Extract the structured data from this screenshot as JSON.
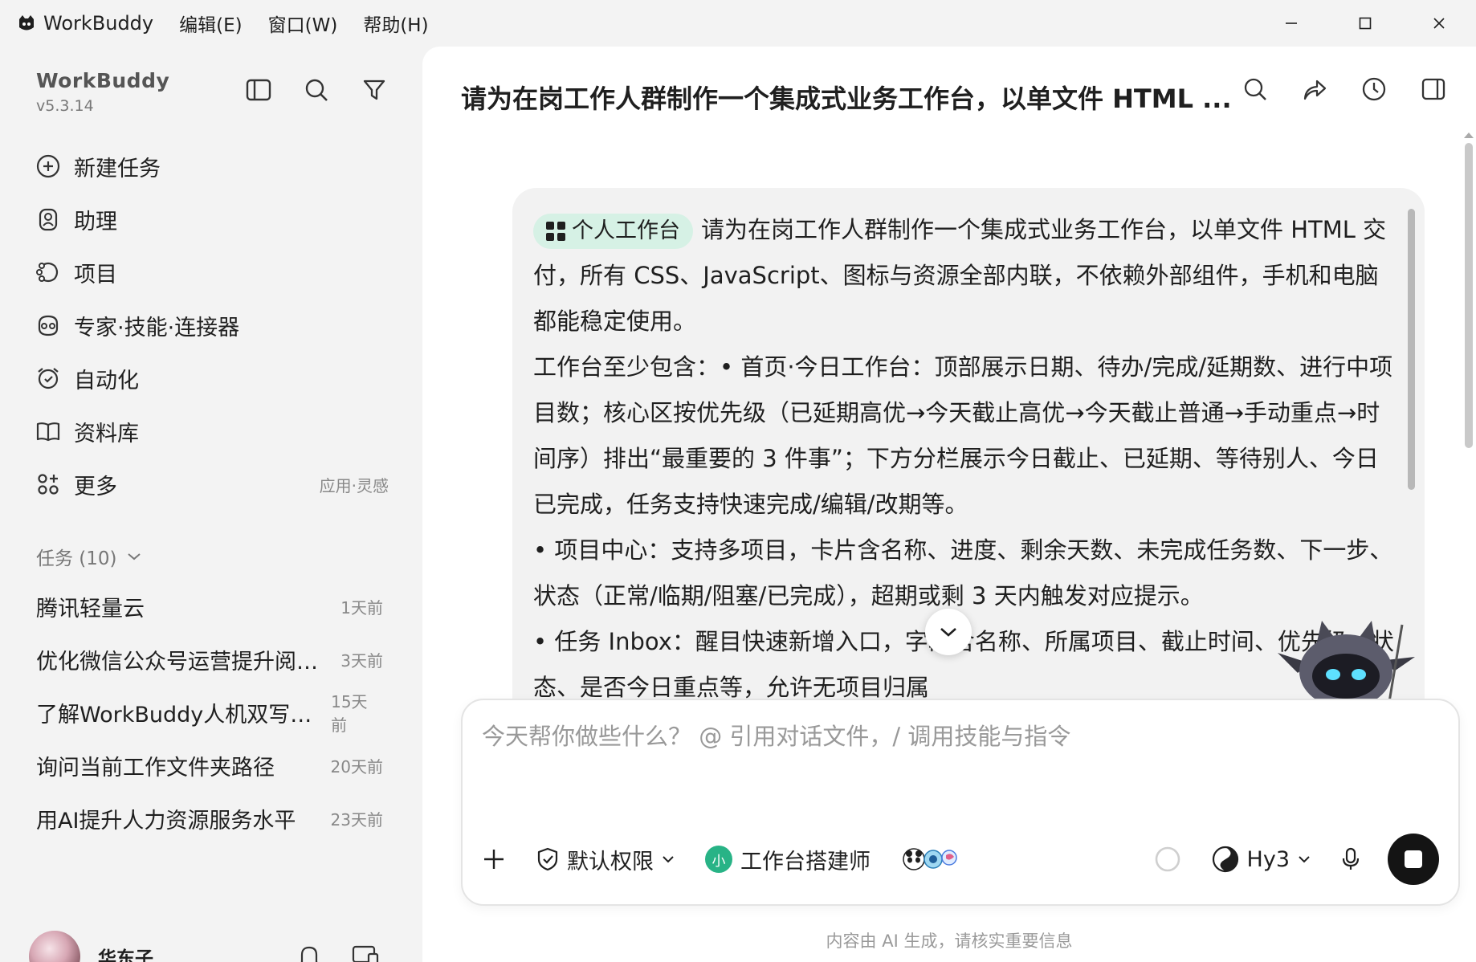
{
  "titlebar": {
    "app_name": "WorkBuddy",
    "menus": [
      "编辑(E)",
      "窗口(W)",
      "帮助(H)"
    ]
  },
  "sidebar": {
    "brand": "WorkBuddy",
    "version": "v5.3.14",
    "nav": [
      {
        "label": "新建任务",
        "icon": "plus-circle-icon"
      },
      {
        "label": "助理",
        "icon": "assistant-icon"
      },
      {
        "label": "项目",
        "icon": "project-icon"
      },
      {
        "label": "专家·技能·连接器",
        "icon": "expert-icon"
      },
      {
        "label": "自动化",
        "icon": "alarm-clock-icon"
      },
      {
        "label": "资料库",
        "icon": "book-icon"
      },
      {
        "label": "更多",
        "icon": "apps-icon",
        "hint": "应用·灵感"
      }
    ],
    "tasks_title": "任务 (10)",
    "tasks": [
      {
        "name": "腾讯轻量云",
        "time": "1天前"
      },
      {
        "name": "优化微信公众号运营提升阅读量",
        "time": "3天前"
      },
      {
        "name": "了解WorkBuddy人机双写方式",
        "time": "15天前"
      },
      {
        "name": "询问当前工作文件夹路径",
        "time": "20天前"
      },
      {
        "name": "用AI提升人力资源服务水平",
        "time": "23天前"
      }
    ],
    "user": {
      "name": "华东子"
    }
  },
  "main": {
    "title": "请为在岗工作人群制作一个集成式业务工作台，以单文件 HTML ...",
    "message": {
      "chip": "个人工作台",
      "paragraphs": [
        "请为在岗工作人群制作一个集成式业务工作台，以单文件 HTML 交付，所有 CSS、JavaScript、图标与资源全部内联，不依赖外部组件，手机和电脑都能稳定使用。",
        "工作台至少包含：• 首页·今日工作台：顶部展示日期、待办/完成/延期数、进行中项目数；核心区按优先级（已延期高优→今天截止高优→今天截止普通→手动重点→时间序）排出“最重要的 3 件事”；下方分栏展示今日截止、已延期、等待别人、今日已完成，任务支持快速完成/编辑/改期等。",
        "• 项目中心：支持多项目，卡片含名称、进度、剩余天数、未完成任务数、下一步、状态（正常/临期/阻塞/已完成），超期或剩 3 天内触发对应提示。",
        "• 任务 Inbox：醒目快速新增入口，字段含名称、所属项目、截止时间、优先级、状态、是否今日重点等，允许无项目归属"
      ]
    },
    "composer": {
      "placeholder": "今天帮你做些什么？ @ 引用对话文件，/ 调用技能与指令",
      "permission": "默认权限",
      "agent_badge": "小",
      "agent": "工作台搭建师",
      "model": "Hy3"
    },
    "disclaimer": "内容由 AI 生成，请核实重要信息"
  },
  "colors": {
    "accent": "#28b386",
    "chip_bg": "#d6f1e5",
    "sidebar_bg": "#f3f3f3",
    "send": "#141414"
  }
}
